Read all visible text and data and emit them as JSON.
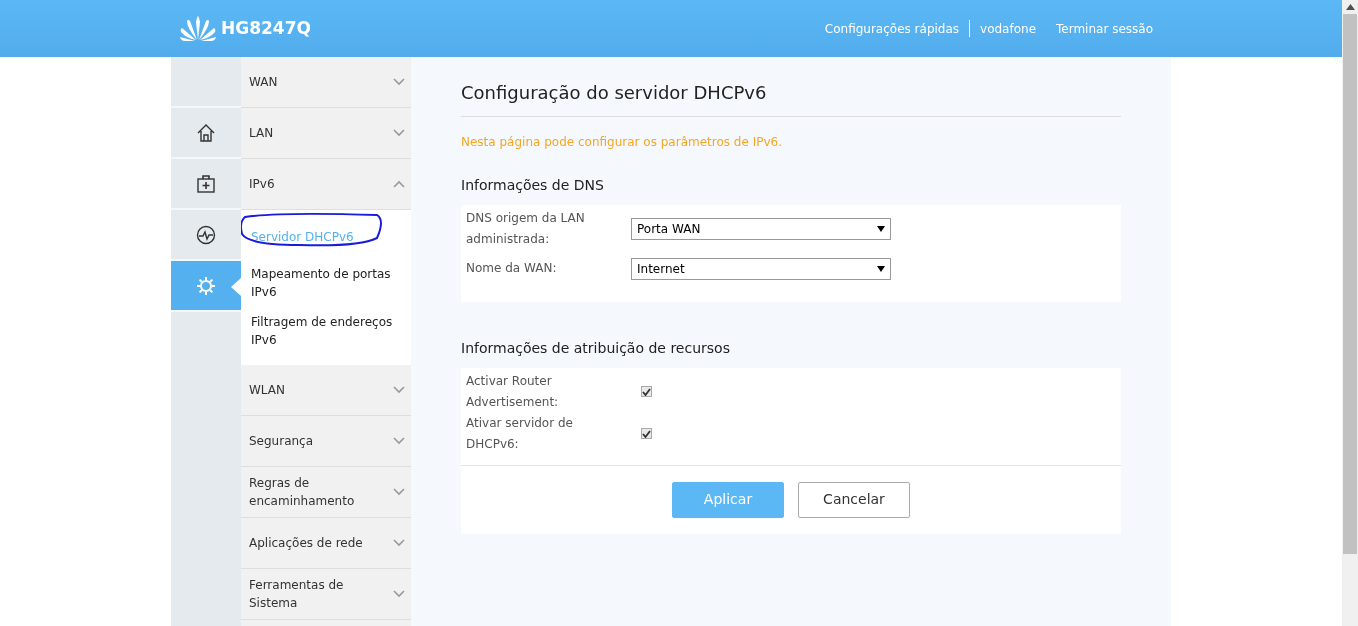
{
  "header": {
    "logo_text": "HG8247Q",
    "links": [
      {
        "label": "Configurações rápidas",
        "separator_after": true
      },
      {
        "label": "vodafone",
        "separator_after": false
      },
      {
        "label": "Terminar sessão",
        "separator_after": false
      }
    ]
  },
  "icon_rail": [
    {
      "kind": "none",
      "selected": false
    },
    {
      "kind": "home",
      "selected": false
    },
    {
      "kind": "medkit",
      "selected": false
    },
    {
      "kind": "pulse",
      "selected": false
    },
    {
      "kind": "gear",
      "selected": true
    }
  ],
  "menu": [
    {
      "label": "WAN",
      "expanded": false
    },
    {
      "label": "LAN",
      "expanded": false
    },
    {
      "label": "IPv6",
      "expanded": true,
      "children": [
        {
          "label": "Servidor DHCPv6",
          "selected": true
        },
        {
          "label": "Mapeamento de portas IPv6",
          "selected": false
        },
        {
          "label": "Filtragem de endereços IPv6",
          "selected": false
        }
      ]
    },
    {
      "label": "WLAN",
      "expanded": false
    },
    {
      "label": "Segurança",
      "expanded": false
    },
    {
      "label": "Regras de encaminhamento",
      "expanded": false
    },
    {
      "label": "Aplicações de rede",
      "expanded": false
    },
    {
      "label": "Ferramentas de Sistema",
      "expanded": false
    }
  ],
  "main": {
    "title": "Configuração do servidor DHCPv6",
    "hint": "Nesta página pode configurar os parâmetros de IPv6.",
    "sections": [
      {
        "heading": "Informações de DNS",
        "fields": [
          {
            "kind": "select",
            "label": "DNS origem da LAN administrada:",
            "value": "Porta WAN"
          },
          {
            "kind": "select",
            "label": "Nome da WAN:",
            "value": "Internet"
          }
        ]
      },
      {
        "heading": "Informações de atribuição de recursos",
        "fields": [
          {
            "kind": "checkbox",
            "label": "Activar Router Advertisement:",
            "checked": true
          },
          {
            "kind": "checkbox",
            "label": "Ativar servidor de DHCPv6:",
            "checked": true
          }
        ],
        "buttons": [
          {
            "label": "Aplicar",
            "kind": "primary"
          },
          {
            "label": "Cancelar",
            "kind": "secondary"
          }
        ]
      }
    ]
  }
}
